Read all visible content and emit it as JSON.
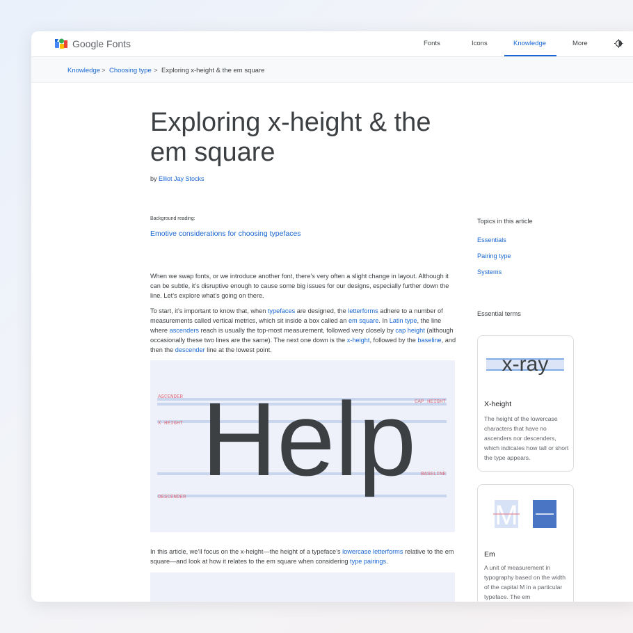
{
  "header": {
    "brand": "Google Fonts",
    "nav": [
      {
        "label": "Fonts"
      },
      {
        "label": "Icons"
      },
      {
        "label": "Knowledge"
      },
      {
        "label": "More"
      }
    ],
    "active_nav": "Knowledge"
  },
  "breadcrumb": {
    "items": [
      "Knowledge",
      "Choosing type",
      "Exploring x-height & the em square"
    ],
    "separator": ">"
  },
  "article": {
    "title_line1": "Exploring x-height & the",
    "title_line2": "em square",
    "byline_prefix": "by",
    "author": "Elliot Jay Stocks",
    "background_label": "Background reading:",
    "background_link": "Emotive considerations for choosing typefaces",
    "para1": "When we swap fonts, or we introduce another font, there’s very often a slight change in layout. Although it can be subtle, it’s disruptive enough to cause some big issues for our designs, especially further down the line. Let’s explore what’s going on there.",
    "para2": {
      "t1": "To start, it’s important to know that, when ",
      "l1": "typefaces",
      "t2": " are designed, the ",
      "l2": "letterforms",
      "t3": " adhere to a number of measurements called vertical metrics, which sit inside a box called an ",
      "l3": "em square",
      "t4": ". In ",
      "l4": "Latin type",
      "t5": ", the line where ",
      "l5": "ascenders",
      "t6": " reach is usually the top-most measurement, followed very closely by ",
      "l6": "cap height",
      "t7": " (although occasionally these two lines are the same). The next one down is the ",
      "l7": "x-height",
      "t8": ", followed by the ",
      "l8": "baseline",
      "t9": ", and then the ",
      "l9": "descender",
      "t10": " line at the lowest point."
    },
    "para3": {
      "t1": "In this article, we’ll focus on the x-height—the height of a typeface’s ",
      "l1": "lowercase letterforms",
      "t2": " relative to the em square—and look at how it relates to the em square when considering ",
      "l2": "type pairings",
      "t3": "."
    }
  },
  "figure": {
    "word": "Help",
    "labels": {
      "ascender": "ASCENDER",
      "cap_height": "CAP HEIGHT",
      "x_height": "X HEIGHT",
      "baseline": "BASELINE",
      "descender": "DESCENDER"
    }
  },
  "sidebar": {
    "topics_heading": "Topics in this article",
    "topics": [
      "Essentials",
      "Pairing type",
      "Systems"
    ],
    "terms_heading": "Essential terms",
    "cards": [
      {
        "sample": "x-ray",
        "title": "X-height",
        "description": "The height of the lowercase characters that have no ascenders nor descenders, which indicates how tall or short the type appears."
      },
      {
        "sample": "M",
        "title": "Em",
        "description": "A unit of measurement in typography based on the width of the capital M in a particular typeface. The em"
      }
    ]
  },
  "colors": {
    "link": "#1967d2",
    "text": "#3c4043",
    "metric_label": "#e0707a",
    "metric_line": "#c9d6ee",
    "figure_bg": "#eef1fa"
  }
}
